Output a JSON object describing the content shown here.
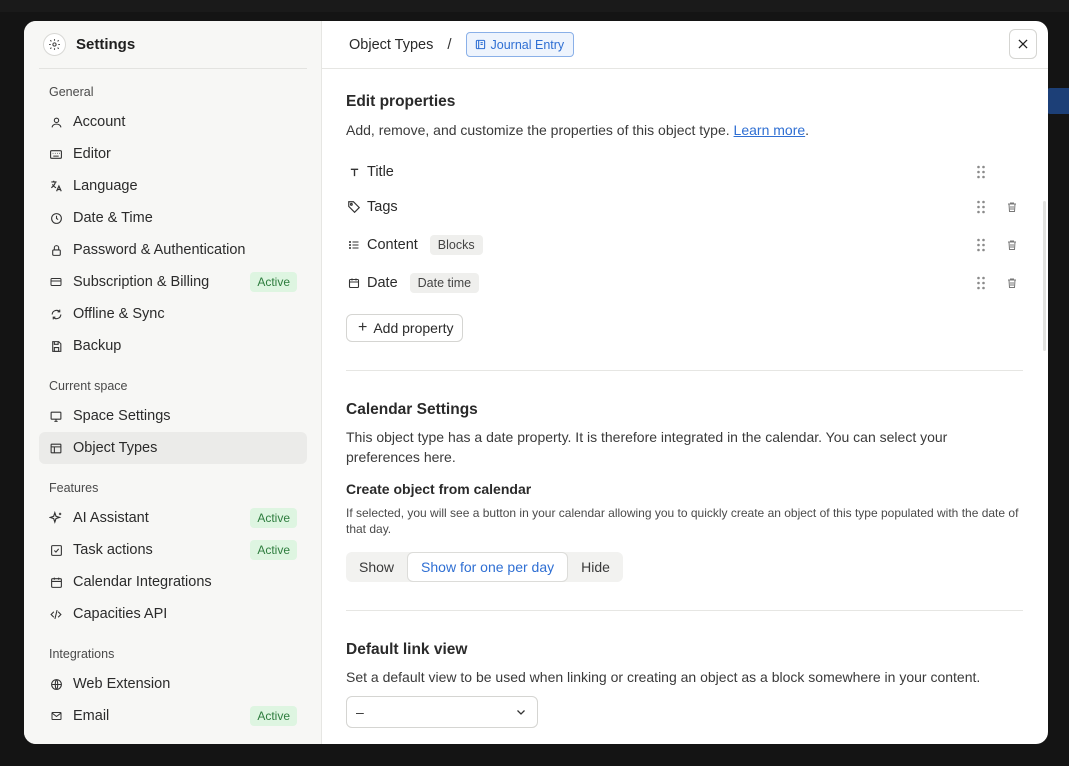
{
  "sidebar": {
    "title": "Settings",
    "sections": {
      "general": "General",
      "current_space": "Current space",
      "features": "Features",
      "integrations": "Integrations"
    },
    "items": {
      "account": "Account",
      "editor": "Editor",
      "language": "Language",
      "date_time": "Date & Time",
      "password": "Password & Authentication",
      "subscription": "Subscription & Billing",
      "offline": "Offline & Sync",
      "backup": "Backup",
      "space_settings": "Space Settings",
      "object_types": "Object Types",
      "ai_assistant": "AI Assistant",
      "task_actions": "Task actions",
      "calendar_integrations": "Calendar Integrations",
      "capacities_api": "Capacities API",
      "web_extension": "Web Extension",
      "email": "Email"
    },
    "badge_label": "Active"
  },
  "header": {
    "breadcrumb_root": "Object Types",
    "breadcrumb_sep": "/",
    "object_type": "Journal Entry"
  },
  "edit_properties": {
    "title": "Edit properties",
    "description": "Add, remove, and customize the properties of this object type.",
    "learn_more": "Learn more",
    "period": ".",
    "properties": [
      {
        "name": "Title",
        "tag": ""
      },
      {
        "name": "Tags",
        "tag": ""
      },
      {
        "name": "Content",
        "tag": "Blocks"
      },
      {
        "name": "Date",
        "tag": "Date time"
      }
    ],
    "add_button": "Add property"
  },
  "calendar_settings": {
    "title": "Calendar Settings",
    "description": "This object type has a date property. It is therefore integrated in the calendar. You can select your preferences here.",
    "create_title": "Create object from calendar",
    "create_desc": "If selected, you will see a button in your calendar allowing you to quickly create an object of this type populated with the date of that day.",
    "options": [
      "Show",
      "Show for one per day",
      "Hide"
    ],
    "selected": "Show for one per day"
  },
  "default_link_view": {
    "title": "Default link view",
    "description": "Set a default view to be used when linking or creating an object as a block somewhere in your content.",
    "value": "–"
  },
  "colors": {
    "accent": "#2f6fd3",
    "badge_bg": "#def5e1",
    "badge_text": "#2e7d3e"
  }
}
